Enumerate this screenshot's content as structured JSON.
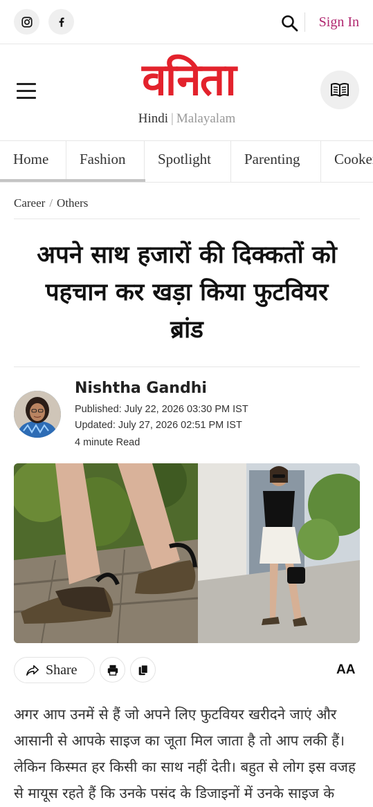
{
  "header": {
    "instagram_icon": "instagram-icon",
    "facebook_icon": "facebook-icon",
    "search_icon": "search-icon",
    "signin_label": "Sign In"
  },
  "brand": {
    "logo_text": "वनिता",
    "lang_hindi": "Hindi",
    "lang_separator": "|",
    "lang_malayalam": "Malayalam",
    "logo_color": "#e3222c"
  },
  "nav": {
    "tabs": [
      {
        "label": "Home"
      },
      {
        "label": "Fashion"
      },
      {
        "label": "Spotlight"
      },
      {
        "label": "Parenting"
      },
      {
        "label": "Cookery"
      }
    ]
  },
  "breadcrumb": {
    "items": [
      "Career",
      "Others"
    ],
    "separator": "/"
  },
  "article": {
    "title": "अपने साथ हजारों की दिक्कतों को पहचान कर खड़ा किया फुटवियर ब्रांड",
    "author": "Nishtha Gandhi",
    "published": "Published: July 22, 2026 03:30 PM IST",
    "updated": "Updated: July 27, 2026 02:51 PM IST",
    "read_time": "4 minute Read",
    "body": "अगर आप उनमें से हैं जो अपने लिए फुटवियर खरीदने जाएं और आसानी से आपके साइज का जूता मिल जाता है तो आप लकी हैं। लेकिन किस्मत हर किसी का साथ नहीं देती। बहुत से लोग इस वजह से मायूस रहते हैं कि उनके पसंद के डिजाइनों में उनके साइज के फुटवियर नहीं मिलते हैं या फिर"
  },
  "actions": {
    "share_label": "Share",
    "text_size_label": "AA"
  },
  "colors": {
    "accent": "#b0256e",
    "brand_red": "#e3222c"
  }
}
